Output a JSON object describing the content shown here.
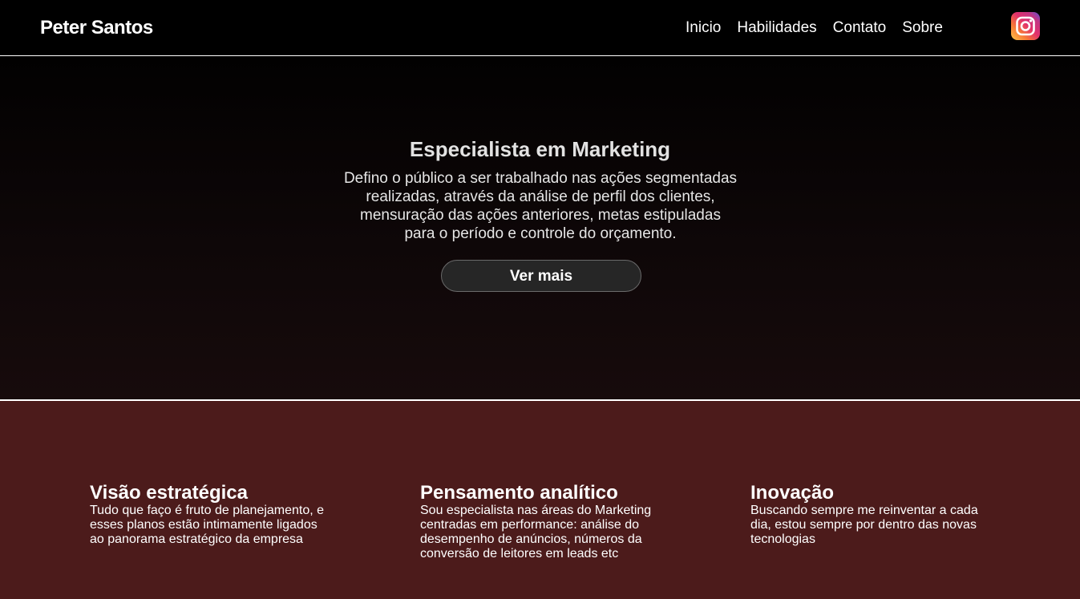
{
  "header": {
    "brand": "Peter Santos",
    "nav": [
      "Inicio",
      "Habilidades",
      "Contato",
      "Sobre"
    ],
    "social_icon": "instagram-icon"
  },
  "hero": {
    "title": "Especialista em Marketing",
    "description": "Defino o público a ser trabalhado nas ações segmentadas realizadas, através da análise de perfil dos clientes, mensuração das ações anteriores, metas estipuladas para o período e controle do orçamento.",
    "button": "Ver mais"
  },
  "features": [
    {
      "title": "Visão estratégica",
      "text": "Tudo que faço é fruto de planejamento, e esses planos estão intimamente ligados ao panorama estratégico da empresa"
    },
    {
      "title": "Pensamento analítico",
      "text": "Sou especialista nas áreas do Marketing centradas em performance: análise do desempenho de anúncios, números da conversão de leitores em leads etc"
    },
    {
      "title": "Inovação",
      "text": "Buscando sempre me reinventar a cada dia, estou sempre por dentro das novas tecnologias"
    }
  ],
  "colors": {
    "nav_bg": "#000000",
    "hero_bg": "#0e0708",
    "features_bg": "#4c1b1b",
    "button_bg": "#262626"
  }
}
